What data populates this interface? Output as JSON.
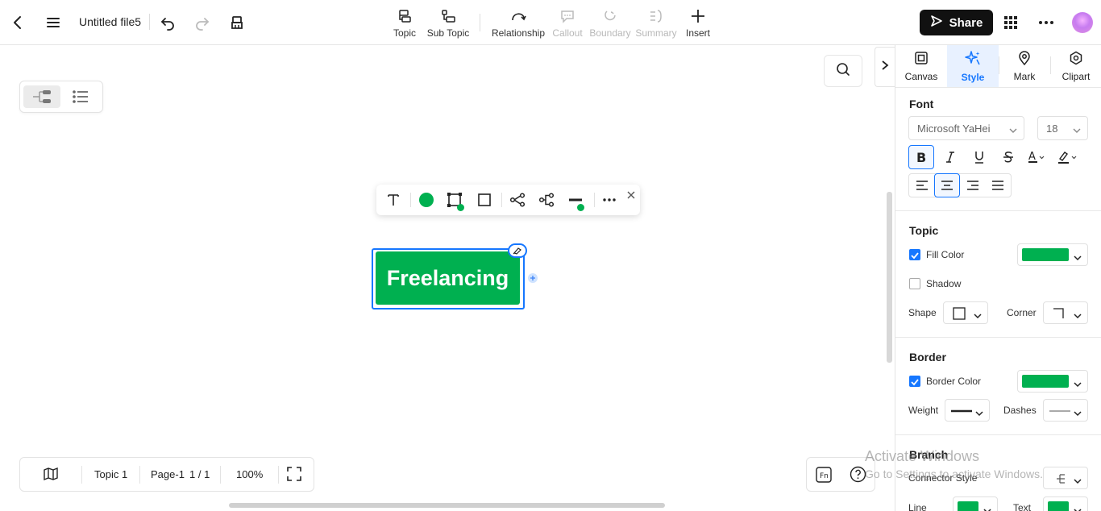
{
  "header": {
    "file_title": "Untitled file5",
    "tools": [
      {
        "label": "Topic",
        "icon": "topic-icon"
      },
      {
        "label": "Sub Topic",
        "icon": "subtopic-icon"
      },
      {
        "label": "Relationship",
        "icon": "relationship-icon"
      },
      {
        "label": "Callout",
        "icon": "callout-icon"
      },
      {
        "label": "Boundary",
        "icon": "boundary-icon"
      },
      {
        "label": "Summary",
        "icon": "summary-icon"
      },
      {
        "label": "Insert",
        "icon": "plus-icon"
      }
    ],
    "share_label": "Share"
  },
  "canvas": {
    "topic_text": "Freelancing",
    "topic_color": "#00b050",
    "selection_color": "#1677ff"
  },
  "status": {
    "topic": "Topic 1",
    "page": "Page-1",
    "page_count": "1 / 1",
    "zoom": "100%"
  },
  "panel": {
    "tabs": [
      {
        "label": "Canvas",
        "icon": "canvas-icon"
      },
      {
        "label": "Style",
        "icon": "style-sparkle-icon",
        "active": true
      },
      {
        "label": "Mark",
        "icon": "mark-icon"
      },
      {
        "label": "Clipart",
        "icon": "clipart-icon"
      }
    ],
    "font": {
      "title": "Font",
      "family": "Microsoft YaHei",
      "size": "18"
    },
    "topic": {
      "title": "Topic",
      "fill_color_label": "Fill Color",
      "fill_color": "#00b050",
      "fill_checked": true,
      "shadow_label": "Shadow",
      "shadow_checked": false,
      "shape_label": "Shape",
      "corner_label": "Corner"
    },
    "border": {
      "title": "Border",
      "color_label": "Border Color",
      "color": "#00b050",
      "color_checked": true,
      "weight_label": "Weight",
      "dashes_label": "Dashes"
    },
    "branch": {
      "title": "Branch",
      "connector_label": "Connector Style",
      "line_label": "Line",
      "text_label": "Text",
      "line_color": "#00b050",
      "text_color": "#00b050"
    }
  },
  "watermark": {
    "line1": "Activate Windows",
    "line2": "Go to Settings to activate Windows."
  }
}
